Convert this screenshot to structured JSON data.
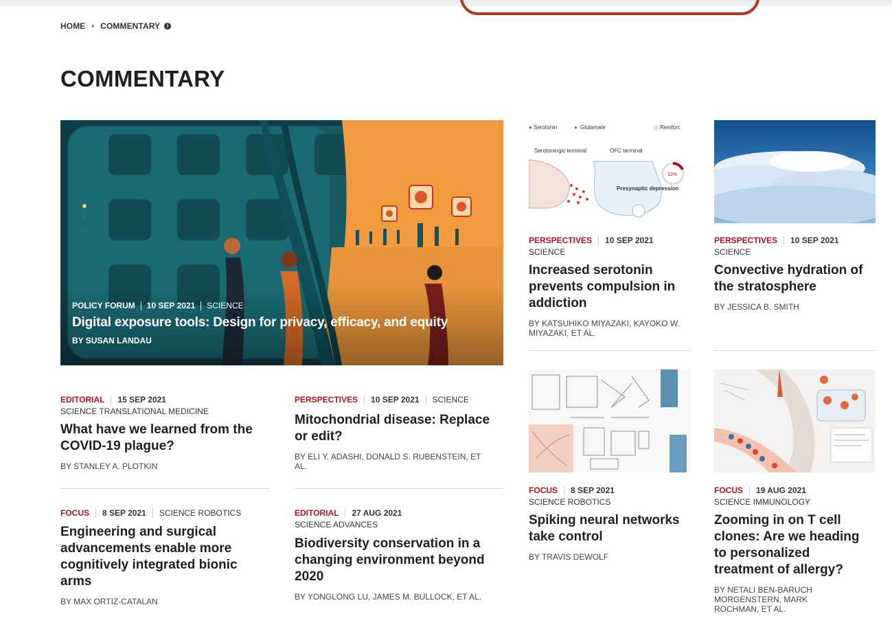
{
  "breadcrumb": {
    "home": "HOME",
    "separator": "›",
    "current": "COMMENTARY",
    "info_icon": "i"
  },
  "page_title": "COMMENTARY",
  "hero": {
    "type": "POLICY FORUM",
    "date": "10 SEP 2021",
    "publication": "SCIENCE",
    "title": "Digital exposure tools: Design for privacy, efficacy, and equity",
    "byline": "BY SUSAN LANDAU"
  },
  "cards": [
    {
      "type": "EDITORIAL",
      "date": "15 SEP 2021",
      "publication": "SCIENCE TRANSLATIONAL MEDICINE",
      "title": "What have we learned from the COVID-19 plague?",
      "byline": "BY STANLEY A. PLOTKIN"
    },
    {
      "type": "PERSPECTIVES",
      "date": "10 SEP 2021",
      "publication": "SCIENCE",
      "title": "Mitochondrial disease: Replace or edit?",
      "byline": "BY ELI Y. ADASHI, DONALD S. RUBENSTEIN, ET AL."
    },
    {
      "type": "FOCUS",
      "date": "8 SEP 2021",
      "publication": "SCIENCE ROBOTICS",
      "title": "Engineering and surgical advancements enable more cognitively integrated bionic arms",
      "byline": "BY MAX ORTIZ-CATALAN"
    },
    {
      "type": "EDITORIAL",
      "date": "27 AUG 2021",
      "publication": "SCIENCE ADVANCES",
      "title": "Biodiversity conservation in a changing environment beyond 2020",
      "byline": "BY YONGLONG LU, JAMES M. BULLOCK, ET AL."
    },
    {
      "type": "PERSPECTIVES",
      "date": "10 SEP 2021",
      "publication": "SCIENCE",
      "title": "Increased serotonin prevents compulsion in addiction",
      "byline": "BY KATSUHIKO MIYAZAKI, KAYOKO W. MIYAZAKI, ET AL.",
      "figure_labels": {
        "serotonin": "Serotonin",
        "glutamate": "Glutamate",
        "reinforcement": "Reinforc",
        "serotonergic": "Serotonergic terminal",
        "ofc": "OFC terminal",
        "presynaptic": "Presynaptic depression",
        "percent": "12%"
      }
    },
    {
      "type": "PERSPECTIVES",
      "date": "10 SEP 2021",
      "publication": "SCIENCE",
      "title": "Convective hydration of the stratosphere",
      "byline": "BY JESSICA B. SMITH"
    },
    {
      "type": "FOCUS",
      "date": "8 SEP 2021",
      "publication": "SCIENCE ROBOTICS",
      "title": "Spiking neural networks take control",
      "byline": "BY TRAVIS DEWOLF"
    },
    {
      "type": "FOCUS",
      "date": "19 AUG 2021",
      "publication": "SCIENCE IMMUNOLOGY",
      "title": "Zooming in on T cell clones: Are we heading to personalized treatment of allergy?",
      "byline": "BY NETALI BEN-BARUCH MORGENSTERN, MARK ROCHMAN, ET AL."
    }
  ],
  "colors": {
    "accent_red": "#b3121d",
    "tab_border": "#b5321c",
    "title_dark": "#1f1f1f"
  }
}
